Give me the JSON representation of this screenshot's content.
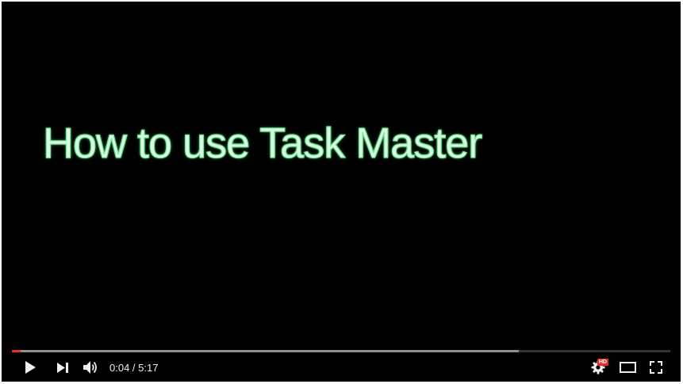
{
  "video": {
    "title": "How to use Task Master"
  },
  "player": {
    "current_time": "0:04",
    "separator": " / ",
    "duration": "5:17",
    "progress_played_fraction": 0.013,
    "progress_buffered_fraction": 0.77,
    "hd_badge": "HD"
  },
  "icons": {
    "play": "play-icon",
    "next": "next-icon",
    "volume": "volume-icon",
    "settings": "gear-icon",
    "theater": "theater-mode-icon",
    "fullscreen": "fullscreen-icon"
  },
  "colors": {
    "accent": "#e52d27",
    "hd_badge": "#e52d27",
    "background": "#000000",
    "title_fill": "#d9ffe4",
    "title_outline": "#7fe39a"
  }
}
